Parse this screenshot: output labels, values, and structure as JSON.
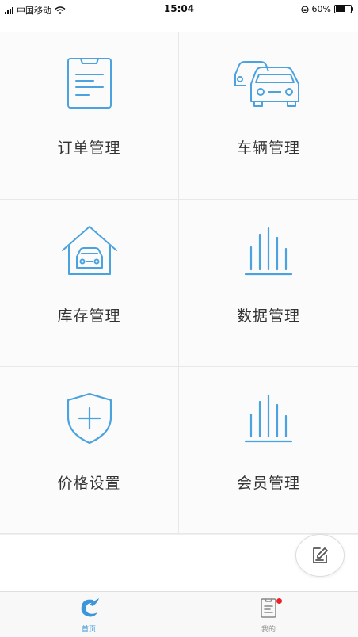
{
  "status_bar": {
    "carrier": "中国移动",
    "time": "15:04",
    "battery": "60%",
    "battery_level": 0.6
  },
  "menu": {
    "items": [
      {
        "label": "订单管理",
        "icon": "document-icon"
      },
      {
        "label": "车辆管理",
        "icon": "cars-icon"
      },
      {
        "label": "库存管理",
        "icon": "garage-icon"
      },
      {
        "label": "数据管理",
        "icon": "bar-chart-icon"
      },
      {
        "label": "价格设置",
        "icon": "shield-plus-icon"
      },
      {
        "label": "会员管理",
        "icon": "bar-chart-icon"
      }
    ]
  },
  "fab": {
    "icon": "edit-icon"
  },
  "tab_bar": {
    "tabs": [
      {
        "label": "首页",
        "icon": "home-logo-icon",
        "active": true
      },
      {
        "label": "我的",
        "icon": "profile-doc-icon",
        "active": false,
        "badge": true
      }
    ]
  },
  "colors": {
    "accent": "#4aa3df",
    "tab_active": "#3b97d9",
    "badge": "#e6252b"
  }
}
